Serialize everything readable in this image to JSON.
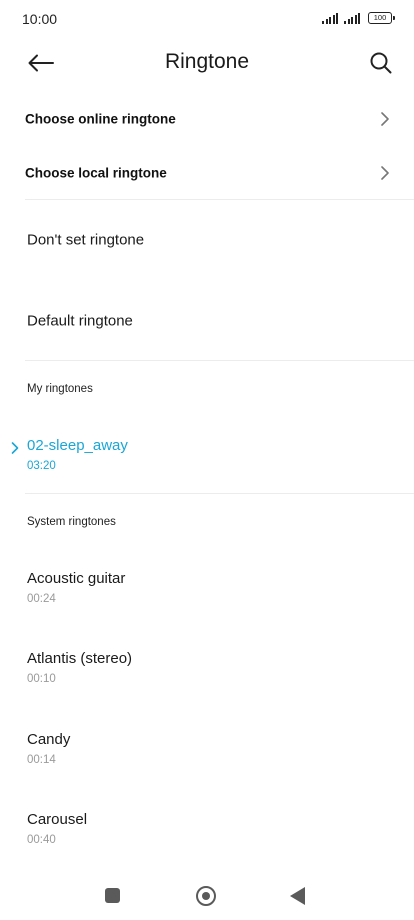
{
  "status_bar": {
    "time": "10:00",
    "battery": "100"
  },
  "header": {
    "title": "Ringtone",
    "back_icon": "arrow-left-icon",
    "search_icon": "search-icon"
  },
  "nav_items": [
    {
      "label": "Choose online ringtone"
    },
    {
      "label": "Choose local ringtone"
    }
  ],
  "options": {
    "dont_set": "Don't set ringtone",
    "default": "Default ringtone"
  },
  "my_ringtones": {
    "header": "My ringtones",
    "items": [
      {
        "title": "02-sleep_away",
        "duration": "03:20",
        "selected": true
      }
    ]
  },
  "system_ringtones": {
    "header": "System ringtones",
    "items": [
      {
        "title": "Acoustic guitar",
        "duration": "00:24"
      },
      {
        "title": "Atlantis (stereo)",
        "duration": "00:10"
      },
      {
        "title": "Candy",
        "duration": "00:14"
      },
      {
        "title": "Carousel",
        "duration": "00:40"
      }
    ]
  },
  "colors": {
    "accent": "#1aa6d6",
    "secondary_text": "#9a9a9a"
  }
}
